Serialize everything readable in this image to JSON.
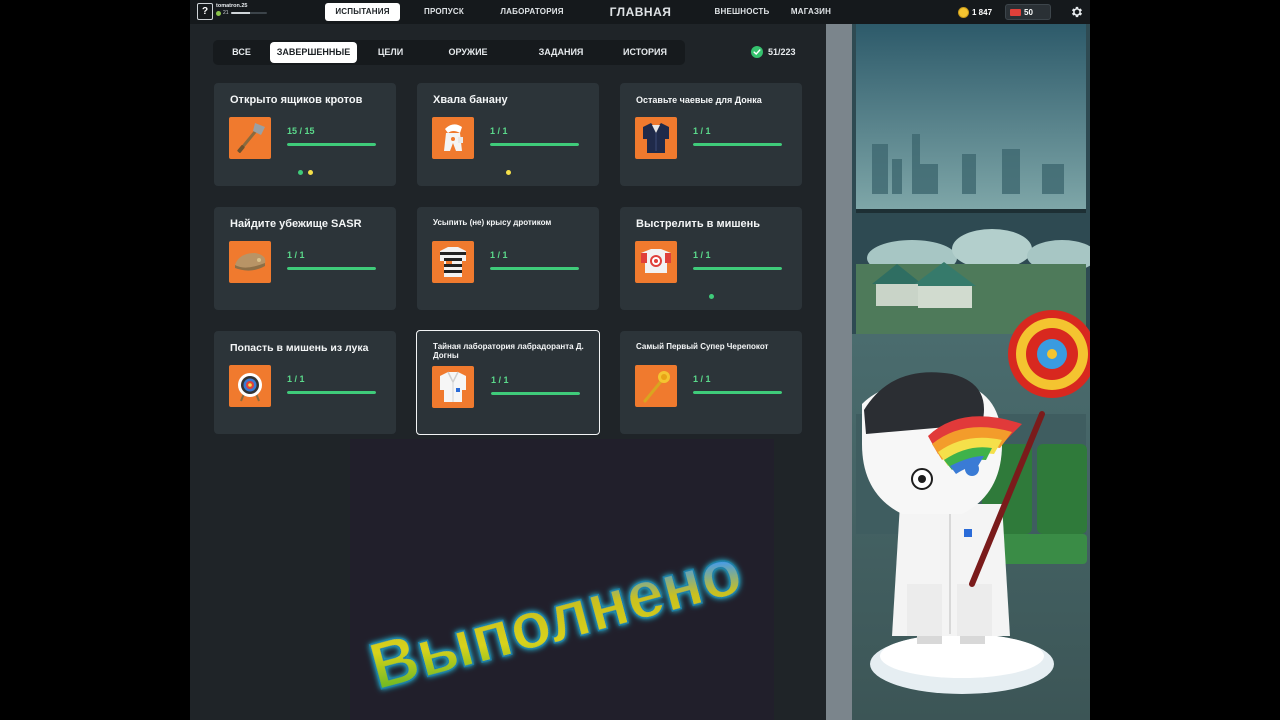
{
  "topbar": {
    "help_label": "?",
    "username": "tomatron.25",
    "level": "21",
    "xp_fraction": 0.55,
    "nav": {
      "challenges": "ИСПЫТАНИЯ",
      "pass": "ПРОПУСК",
      "lab": "ЛАБОРАТОРИЯ",
      "main": "ГЛАВНАЯ",
      "appearance": "ВНЕШНОСТЬ",
      "shop": "МАГАЗИН"
    },
    "coins": "1 847",
    "tickets": "50"
  },
  "filters": {
    "all": "ВСЕ",
    "completed": "ЗАВЕРШЕННЫЕ",
    "goals": "ЦЕЛИ",
    "weapons": "ОРУЖИЕ",
    "tasks": "ЗАДАНИЯ",
    "history": "ИСТОРИЯ"
  },
  "counter": "51/223",
  "cards": [
    {
      "title": "Открыто ящиков кротов",
      "progress": "15 / 15",
      "fraction": 1,
      "icon": "shovel-icon"
    },
    {
      "title": "Хвала банану",
      "progress": "1 / 1",
      "fraction": 1,
      "icon": "banana-costume-icon"
    },
    {
      "title": "Оставьте чаевые для Донка",
      "progress": "1 / 1",
      "fraction": 1,
      "icon": "suit-icon"
    },
    {
      "title": "Найдите убежище SASR",
      "progress": "1 / 1",
      "fraction": 1,
      "icon": "beret-icon"
    },
    {
      "title": "Усыпить (не) крысу дротиком",
      "progress": "1 / 1",
      "fraction": 1,
      "icon": "prison-shirt-icon"
    },
    {
      "title": "Выстрелить в мишень",
      "progress": "1 / 1",
      "fraction": 1,
      "icon": "target-shirt-icon"
    },
    {
      "title": "Попасть в мишень из лука",
      "progress": "1 / 1",
      "fraction": 1,
      "icon": "archery-target-icon"
    },
    {
      "title": "Тайная лаборатория лабрадоранта Д. Догны",
      "progress": "1 / 1",
      "fraction": 1,
      "icon": "lab-coat-icon"
    },
    {
      "title": "Самый Первый Супер Черепокот",
      "progress": "1 / 1",
      "fraction": 1,
      "icon": "golden-scepter-icon"
    }
  ],
  "overlay_text": "Выполнено",
  "colors": {
    "accent_green": "#3fcb7a",
    "card_icon_bg": "#f07a2e",
    "dot_green": "#3fcb7a",
    "dot_yellow": "#f5e04a"
  }
}
